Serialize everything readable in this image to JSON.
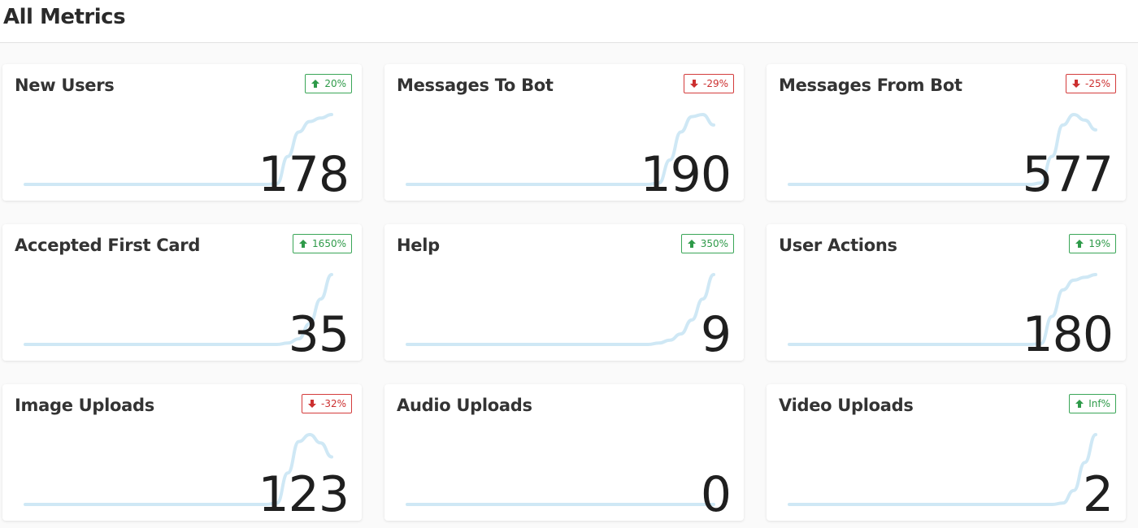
{
  "header": {
    "title": "All Metrics"
  },
  "colors": {
    "up": "#3aa657",
    "down": "#d43c3c",
    "sparkline": "#cfe8f5"
  },
  "cards": [
    {
      "title": "New Users",
      "value": "178",
      "change": "20%",
      "direction": "up",
      "icon": "arrow-up-icon",
      "trend": [
        0,
        0,
        0,
        0,
        0,
        0,
        0,
        0,
        0,
        0,
        0,
        0,
        0,
        0,
        0,
        0,
        0,
        0,
        0,
        0,
        0,
        0,
        0,
        0.01,
        0.4,
        0.75,
        0.9,
        0.95,
        1
      ]
    },
    {
      "title": "Messages To Bot",
      "value": "190",
      "change": "-29%",
      "direction": "down",
      "icon": "arrow-down-icon",
      "trend": [
        0,
        0,
        0,
        0,
        0,
        0,
        0,
        0,
        0,
        0,
        0,
        0,
        0,
        0,
        0,
        0,
        0,
        0,
        0,
        0,
        0,
        0,
        0,
        0.02,
        0.35,
        0.75,
        0.97,
        1,
        0.85
      ]
    },
    {
      "title": "Messages From Bot",
      "value": "577",
      "change": "-25%",
      "direction": "down",
      "icon": "arrow-down-icon",
      "trend": [
        0,
        0,
        0,
        0,
        0,
        0,
        0,
        0,
        0,
        0,
        0,
        0,
        0,
        0,
        0,
        0,
        0,
        0,
        0,
        0,
        0,
        0,
        0,
        0.02,
        0.4,
        0.85,
        1,
        0.92,
        0.78
      ]
    },
    {
      "title": "Accepted First Card",
      "value": "35",
      "change": "1650%",
      "direction": "up",
      "icon": "arrow-up-icon",
      "trend": [
        0,
        0,
        0,
        0,
        0,
        0,
        0,
        0,
        0,
        0,
        0,
        0,
        0,
        0,
        0,
        0,
        0,
        0,
        0,
        0,
        0,
        0,
        0,
        0,
        0.02,
        0.08,
        0.3,
        0.65,
        1
      ]
    },
    {
      "title": "Help",
      "value": "9",
      "change": "350%",
      "direction": "up",
      "icon": "arrow-up-icon",
      "trend": [
        0,
        0,
        0,
        0,
        0,
        0,
        0,
        0,
        0,
        0,
        0,
        0,
        0,
        0,
        0,
        0,
        0,
        0,
        0,
        0,
        0,
        0,
        0,
        0.02,
        0.06,
        0.15,
        0.35,
        0.65,
        1
      ]
    },
    {
      "title": "User Actions",
      "value": "180",
      "change": "19%",
      "direction": "up",
      "icon": "arrow-up-icon",
      "trend": [
        0,
        0,
        0,
        0,
        0,
        0,
        0,
        0,
        0,
        0,
        0,
        0,
        0,
        0,
        0,
        0,
        0,
        0,
        0,
        0,
        0,
        0,
        0,
        0.01,
        0.4,
        0.78,
        0.92,
        0.96,
        1
      ]
    },
    {
      "title": "Image Uploads",
      "value": "123",
      "change": "-32%",
      "direction": "down",
      "icon": "arrow-down-icon",
      "trend": [
        0,
        0,
        0,
        0,
        0,
        0,
        0,
        0,
        0,
        0,
        0,
        0,
        0,
        0,
        0,
        0,
        0,
        0,
        0,
        0,
        0,
        0,
        0,
        0.02,
        0.45,
        0.9,
        1,
        0.88,
        0.68
      ]
    },
    {
      "title": "Audio Uploads",
      "value": "0",
      "change": "",
      "direction": "none",
      "icon": "",
      "trend": [
        0,
        0,
        0,
        0,
        0,
        0,
        0,
        0,
        0,
        0,
        0,
        0,
        0,
        0,
        0,
        0,
        0,
        0,
        0,
        0,
        0,
        0,
        0,
        0,
        0,
        0,
        0,
        0,
        0
      ]
    },
    {
      "title": "Video Uploads",
      "value": "2",
      "change": "Inf%",
      "direction": "up",
      "icon": "arrow-up-icon",
      "trend": [
        0,
        0,
        0,
        0,
        0,
        0,
        0,
        0,
        0,
        0,
        0,
        0,
        0,
        0,
        0,
        0,
        0,
        0,
        0,
        0,
        0,
        0,
        0,
        0,
        0,
        0.02,
        0.2,
        0.6,
        1
      ]
    }
  ]
}
